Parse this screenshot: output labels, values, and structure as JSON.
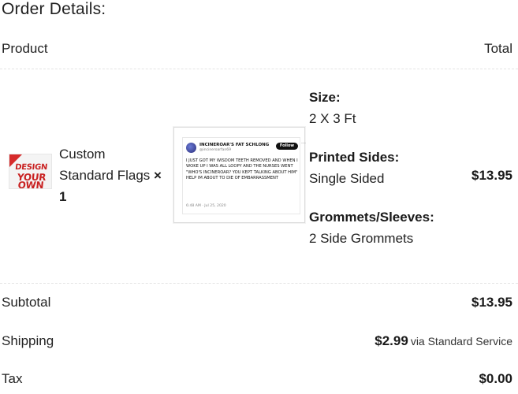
{
  "heading": "Order Details:",
  "columns": {
    "product": "Product",
    "total": "Total"
  },
  "line_item": {
    "thumbnail": {
      "corner_badge": "(R)",
      "line1": "DESIGN",
      "line2": "YOUR OWN",
      "accent": "#c92222"
    },
    "name_line1": "Custom",
    "name_line2": "Standard Flags",
    "qty_mult": "×",
    "quantity": "1",
    "preview": {
      "name": "INCINEROAR'S FAT SCHLONG",
      "handle": "@incineroarfan69",
      "follow": "Follow",
      "more": "···",
      "text": "I JUST GOT MY WISDOM TEETH REMOVED AND WHEN I WOKE UP I WAS ALL LOOPY AND THE NURSES WENT \"WHO'S INCINEROAR? YOU KEPT TALKING ABOUT HIM\" HELP IM ABOUT TO DIE OF EMBARRASSMENT",
      "time": "6:48 AM · Jul 25, 2020"
    },
    "options": [
      {
        "label": "Size:",
        "value": "2 X 3 Ft"
      },
      {
        "label": "Printed Sides:",
        "value": "Single Sided"
      },
      {
        "label": "Grommets/Sleeves:",
        "value": "2 Side Grommets"
      }
    ],
    "total": "$13.95"
  },
  "summary": {
    "subtotal_label": "Subtotal",
    "subtotal_value": "$13.95",
    "shipping_label": "Shipping",
    "shipping_amount": "$2.99",
    "shipping_via": "via Standard Service",
    "tax_label": "Tax",
    "tax_value": "$0.00"
  }
}
